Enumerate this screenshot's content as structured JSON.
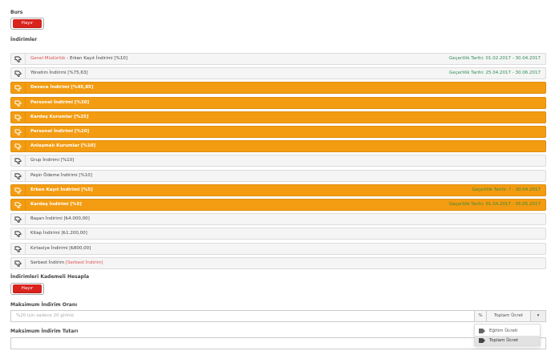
{
  "burs": {
    "label": "Burs",
    "toggle": "Hayır"
  },
  "indirimler": {
    "label": "İndirimler",
    "items": [
      {
        "pre": "Genel Müdürlük",
        "text": " - Erken Kayıt İndirimi [%10]",
        "date": "Geçerlilik Tarihi: 01.02.2017 - 30.04.2017"
      },
      {
        "pre": "",
        "text": "Yönetim İndirimi [%75,63]",
        "date": "Geçerlilik Tarihi: 25.04.2017 - 30.06.2017"
      },
      {
        "pre": "",
        "text": "Devece İndirimi [%45,85]",
        "date": ""
      },
      {
        "pre": "",
        "text": "Personel İndirimi [%30]",
        "date": ""
      },
      {
        "pre": "",
        "text": "Kardeş Kurumlar [%25]",
        "date": ""
      },
      {
        "pre": "",
        "text": "Personel İndirimi [%20]",
        "date": ""
      },
      {
        "pre": "",
        "text": "Anlaşmalı Kurumlar [%10]",
        "date": ""
      },
      {
        "pre": "",
        "text": "Grup İndirimi [%10]",
        "date": ""
      },
      {
        "pre": "",
        "text": "Peşin Ödeme İndirimi [%10]",
        "date": ""
      },
      {
        "pre": "",
        "text": "Erken Kayıt İndirimi [%5]",
        "date": "Geçerlilik Tarihi: ? - 30.04.2017"
      },
      {
        "pre": "",
        "text": "Kardeş İndirimi [%5]",
        "date": "Geçerlilik Tarihi: 01.04.2017 - 35.05.2017"
      },
      {
        "pre": "",
        "text": "Başarı İndirimi [₺4.000,00]",
        "date": ""
      },
      {
        "pre": "",
        "text": "Kitap İndirimi [₺1.200,00]",
        "date": ""
      },
      {
        "pre": "",
        "text": "Kırtasiye İndirimi [₺800,00]",
        "date": ""
      },
      {
        "pre": "",
        "text": "Serbest İndirim ",
        "suffix": "[Serbest İndirim]",
        "date": ""
      }
    ]
  },
  "kademeli": {
    "label": "İndirimleri Kademeli Hesapla",
    "toggle": "Hayır"
  },
  "max_oran": {
    "label": "Maksimum İndirim Oranı",
    "placeholder": "%20 için sadece 20 giriniz",
    "percent": "%",
    "select_value": "Toplam Ücret",
    "caret": "▾"
  },
  "max_tutar": {
    "label": "Maksimum İndirim Tutarı"
  },
  "dropdown": {
    "options": [
      "Eğitim Ücreti",
      "Toplam Ücret"
    ],
    "selected": "Toplam Ücret"
  },
  "colors": {
    "orange": "#f39c12",
    "red": "#d9231d",
    "green": "#2e8b57"
  }
}
